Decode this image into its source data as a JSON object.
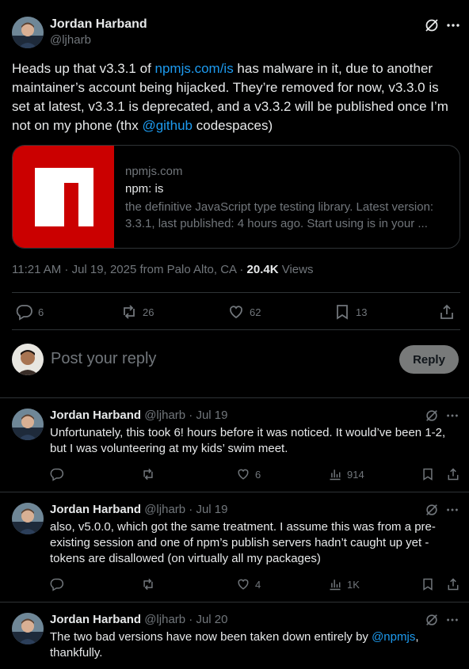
{
  "main_tweet": {
    "author_name": "Jordan Harband",
    "author_handle": "@ljharb",
    "text_parts": {
      "p1": "Heads up that v3.3.1 of ",
      "link1": "npmjs.com/is",
      "p2": " has malware in it, due to another maintainer’s account being hijacked. They’re removed for now, v3.3.0 is set at latest, v3.3.1 is deprecated, and a v3.3.2 will be published once I’m not on my phone (thx ",
      "link2": "@github",
      "p3": " codespaces)"
    },
    "card": {
      "domain": "npmjs.com",
      "title": "npm: is",
      "description": "the definitive JavaScript type testing library. Latest version: 3.3.1, last published: 4 hours ago. Start using is in your ..."
    },
    "timestamp": "11:21 AM · Jul 19, 2025 from Palo Alto, CA · ",
    "views_count": "20.4K",
    "views_label": " Views",
    "stats": {
      "replies": "6",
      "retweets": "26",
      "likes": "62",
      "bookmarks": "13"
    }
  },
  "reply_box": {
    "placeholder": "Post your reply",
    "button_label": "Reply"
  },
  "replies": [
    {
      "author_name": "Jordan Harband",
      "author_handle": "@ljharb",
      "date": " · Jul 19",
      "text": "Unfortunately, this took 6! hours before it was noticed. It would’ve been 1-2, but I was volunteering at my kids’ swim meet.",
      "likes": "6",
      "views": "914"
    },
    {
      "author_name": "Jordan Harband",
      "author_handle": "@ljharb",
      "date": " · Jul 19",
      "text": "also, v5.0.0, which got the same treatment. I assume this was from a pre-existing session and one of npm’s publish servers hadn’t caught up yet - tokens are disallowed (on virtually all my packages)",
      "likes": "4",
      "views": "1K"
    },
    {
      "author_name": "Jordan Harband",
      "author_handle": "@ljharb",
      "date": " · Jul 20",
      "text_p1": "The two bad versions have now been taken down entirely by ",
      "text_link": "@npmjs",
      "text_p2": ",\nthankfully."
    }
  ]
}
